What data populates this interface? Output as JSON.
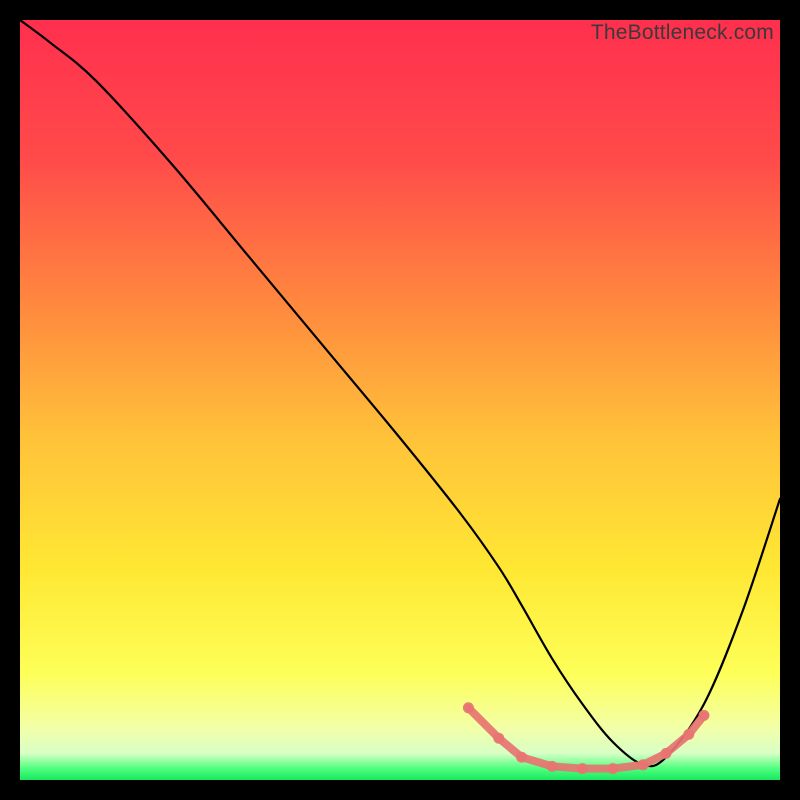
{
  "watermark": "TheBottleneck.com",
  "colors": {
    "gradient_stops": [
      {
        "offset": 0.0,
        "color": "#ff2f4e"
      },
      {
        "offset": 0.18,
        "color": "#ff4a4a"
      },
      {
        "offset": 0.38,
        "color": "#ff8a3e"
      },
      {
        "offset": 0.55,
        "color": "#ffc23a"
      },
      {
        "offset": 0.72,
        "color": "#ffe733"
      },
      {
        "offset": 0.86,
        "color": "#fdff58"
      },
      {
        "offset": 0.93,
        "color": "#f3ffa6"
      },
      {
        "offset": 0.965,
        "color": "#d8ffc6"
      },
      {
        "offset": 0.985,
        "color": "#4fff7e"
      },
      {
        "offset": 1.0,
        "color": "#19e860"
      }
    ],
    "curve": "#000000",
    "overlay": "#e77471",
    "frame_bg": "#000000"
  },
  "chart_data": {
    "type": "line",
    "title": "",
    "xlabel": "",
    "ylabel": "",
    "xlim": [
      0,
      100
    ],
    "ylim": [
      0,
      100
    ],
    "series": [
      {
        "name": "bottleneck-curve",
        "x": [
          0,
          4,
          10,
          20,
          30,
          40,
          50,
          58,
          63,
          66,
          70,
          74,
          78,
          82,
          85,
          90,
          95,
          100
        ],
        "y": [
          100,
          97,
          92,
          81,
          69,
          57,
          45,
          35,
          28,
          23,
          16,
          10,
          5,
          2,
          3,
          10,
          22,
          37
        ]
      }
    ],
    "highlighted_region": {
      "name": "optimal-range",
      "points": [
        {
          "x": 59,
          "y": 9.5
        },
        {
          "x": 63,
          "y": 5.5
        },
        {
          "x": 66,
          "y": 3
        },
        {
          "x": 70,
          "y": 1.8
        },
        {
          "x": 74,
          "y": 1.5
        },
        {
          "x": 78,
          "y": 1.5
        },
        {
          "x": 82,
          "y": 2
        },
        {
          "x": 85,
          "y": 3.5
        },
        {
          "x": 88,
          "y": 6
        },
        {
          "x": 90,
          "y": 8.5
        }
      ]
    }
  }
}
